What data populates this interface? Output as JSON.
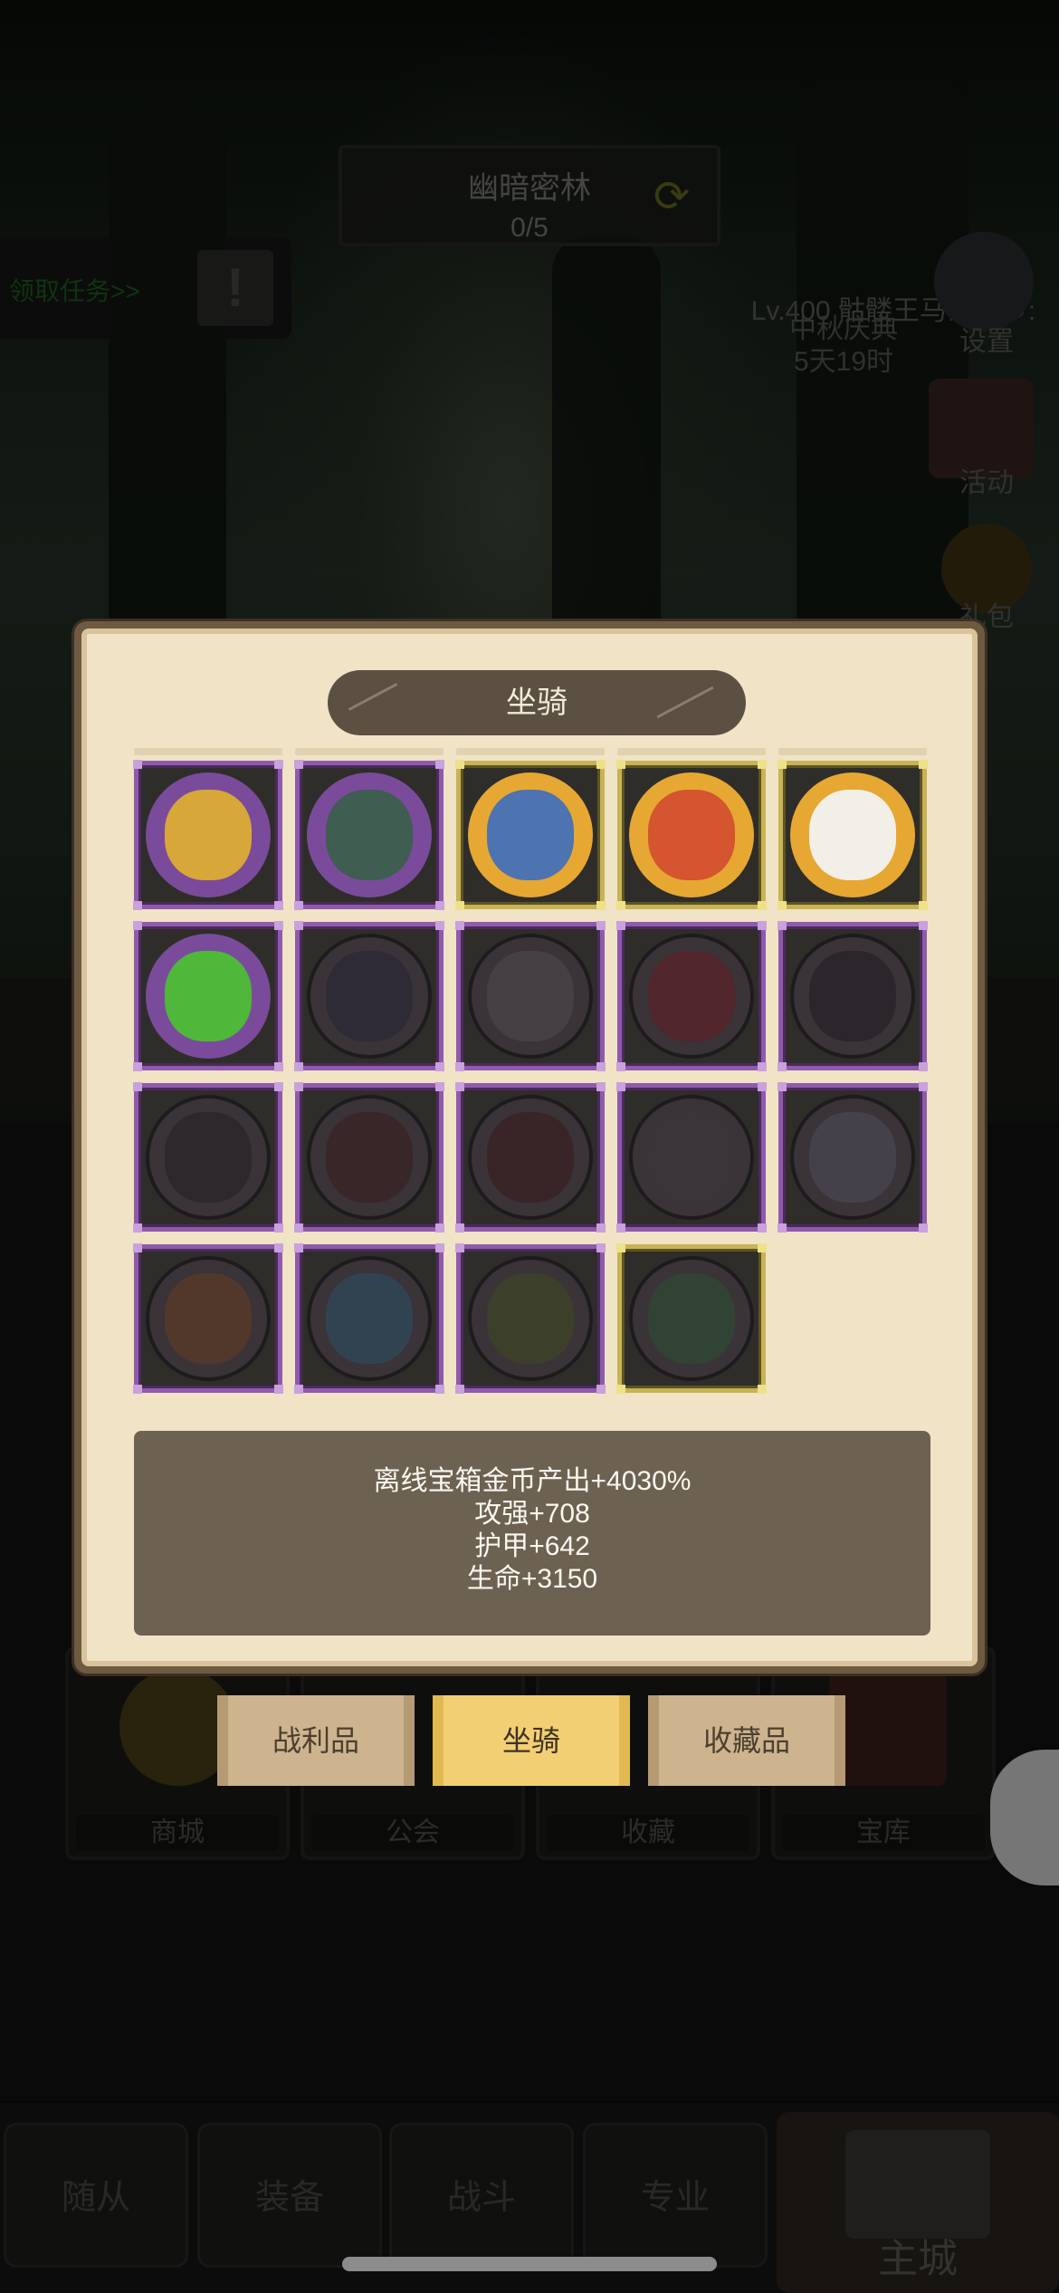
{
  "location": {
    "name": "幽暗密林",
    "progress": "0/5"
  },
  "quest": {
    "label": "领取任务>>"
  },
  "header_overlay": {
    "level_text": "Lv.400 骷髅王马砍菠萝:",
    "event": "中秋庆典",
    "countdown": "5天19时"
  },
  "side_menu": {
    "settings": "设置",
    "activity": "活动",
    "gift": "礼包"
  },
  "shop_row": [
    "商城",
    "公会",
    "收藏",
    "宝库"
  ],
  "bottom_nav": {
    "tabs": [
      "随从",
      "装备",
      "战斗",
      "专业"
    ],
    "home": "主城"
  },
  "dialog": {
    "title": "坐骑",
    "mounts": [
      {
        "rarity": "purple",
        "icon": "skeleton-dragon-icon",
        "color": "#d7a73a",
        "locked": false
      },
      {
        "rarity": "purple",
        "icon": "stone-golem-icon",
        "color": "#3f5d50",
        "locked": false
      },
      {
        "rarity": "gold",
        "icon": "shark-icon",
        "color": "#4d73b0",
        "locked": false
      },
      {
        "rarity": "gold",
        "icon": "mech-beast-icon",
        "color": "#d4552f",
        "locked": false
      },
      {
        "rarity": "gold",
        "icon": "white-fox-icon",
        "color": "#f2eee8",
        "locked": false
      },
      {
        "rarity": "purple",
        "icon": "green-beast-icon",
        "color": "#4fb73a",
        "locked": false
      },
      {
        "rarity": "purple",
        "icon": "raven-icon",
        "color": "#2c2a36",
        "locked": true
      },
      {
        "rarity": "purple",
        "icon": "wolf-icon",
        "color": "#4a4648",
        "locked": true
      },
      {
        "rarity": "purple",
        "icon": "red-armor-icon",
        "color": "#5a2328",
        "locked": true
      },
      {
        "rarity": "purple",
        "icon": "panther-icon",
        "color": "#262327",
        "locked": true
      },
      {
        "rarity": "purple",
        "icon": "rhino-icon",
        "color": "#2a2628",
        "locked": true
      },
      {
        "rarity": "purple",
        "icon": "horse-icon",
        "color": "#3a2324",
        "locked": true
      },
      {
        "rarity": "purple",
        "icon": "dark-horse-icon",
        "color": "#3a2222",
        "locked": true
      },
      {
        "rarity": "purple",
        "icon": "armored-beast-icon",
        "color": "#3a3739",
        "locked": true
      },
      {
        "rarity": "purple",
        "icon": "silver-knight-icon",
        "color": "#4a4750",
        "locked": true
      },
      {
        "rarity": "purple",
        "icon": "hex-turtle-icon",
        "color": "#5a3b25",
        "locked": true
      },
      {
        "rarity": "purple",
        "icon": "blue-crystal-icon",
        "color": "#2f4a5a",
        "locked": true
      },
      {
        "rarity": "purple",
        "icon": "lizard-icon",
        "color": "#3d4426",
        "locked": true
      },
      {
        "rarity": "gold",
        "icon": "green-frog-icon",
        "color": "#2e4a33",
        "locked": true
      }
    ],
    "stats": [
      "离线宝箱金币产出+4030%",
      "攻强+708",
      "护甲+642",
      "生命+3150"
    ]
  },
  "tabs": [
    {
      "label": "战利品",
      "active": false
    },
    {
      "label": "坐骑",
      "active": true
    },
    {
      "label": "收藏品",
      "active": false
    }
  ]
}
